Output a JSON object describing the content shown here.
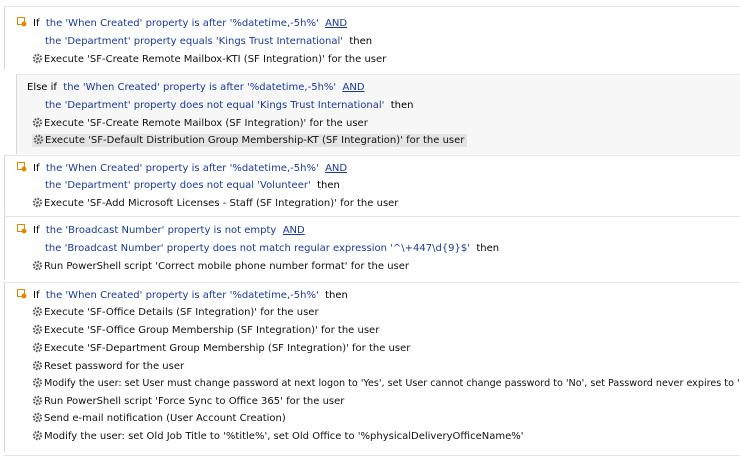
{
  "rules": [
    {
      "condition": [
        {
          "kw": "If",
          "text": "the 'When Created' property is after '%datetime,-5h%'",
          "op": "AND"
        },
        {
          "text": "the 'Department' property equals 'Kings Trust International'",
          "then": "then"
        }
      ],
      "actions": [
        "Execute 'SF-Create Remote Mailbox-KTI (SF Integration)' for the user"
      ]
    },
    {
      "condition": [
        {
          "kw": "Else if",
          "text": "the 'When Created' property is after '%datetime,-5h%'",
          "op": "AND"
        },
        {
          "text": "the 'Department' property does not equal 'Kings Trust International'",
          "then": "then"
        }
      ],
      "actions": [
        "Execute 'SF-Create Remote Mailbox (SF Integration)' for the user",
        "Execute 'SF-Default Distribution Group Membership-KT (SF Integration)' for the user"
      ]
    },
    {
      "condition": [
        {
          "kw": "If",
          "text": "the 'When Created' property is after '%datetime,-5h%'",
          "op": "AND"
        },
        {
          "text": "the 'Department' property does not equal 'Volunteer'",
          "then": "then"
        }
      ],
      "actions": [
        "Execute 'SF-Add Microsoft Licenses - Staff (SF Integration)' for the user"
      ]
    },
    {
      "condition": [
        {
          "kw": "If",
          "text": "the 'Broadcast Number' property is not empty",
          "op": "AND"
        },
        {
          "text": "the 'Broadcast Number' property does not match regular expression '^\\+447\\d{9}$'",
          "then": "then"
        }
      ],
      "actions": [
        "Run PowerShell script 'Correct mobile phone number format' for the user"
      ]
    },
    {
      "condition": [
        {
          "kw": "If",
          "text": "the 'When Created' property is after '%datetime,-5h%'",
          "then": "then"
        }
      ],
      "actions": [
        "Execute 'SF-Office Details (SF Integration)' for the user",
        "Execute 'SF-Office Group Membership (SF Integration)' for the user",
        "Execute 'SF-Department Group Membership (SF Integration)' for the user",
        "Reset password for the user",
        "Modify the user: set User must change password at next logon to 'Yes', set User cannot change password to 'No', set Password never expires to 'No'",
        "Run PowerShell script 'Force Sync to Office 365' for the user",
        "Send e-mail notification (User Account Creation)",
        "Modify the user: set Old Job Title to '%title%', set Old Office to '%physicalDeliveryOfficeName%'"
      ]
    }
  ],
  "icons": {
    "condition": "condition-icon",
    "action": "gear-icon"
  },
  "colors": {
    "condition_text": "#1a3a99",
    "selection_bg": "#e4e4e4",
    "inner_block_bg": "#f7f7f7",
    "icon_orange": "#e08a00"
  }
}
